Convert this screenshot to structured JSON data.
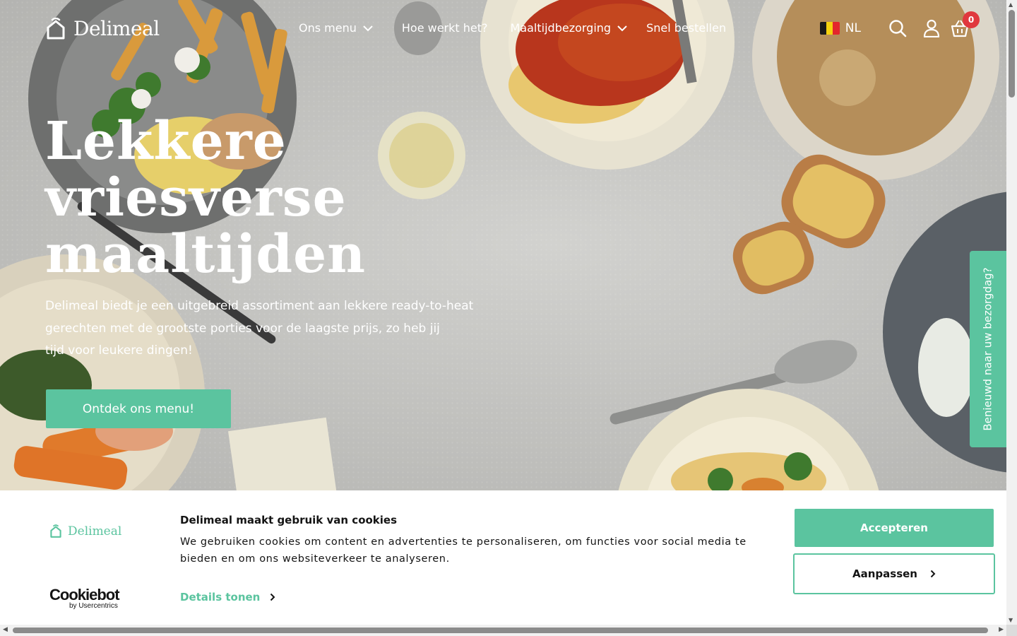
{
  "brand": {
    "name": "Delimeal",
    "accent": "#5bc49f",
    "badge_color": "#e0383e"
  },
  "nav": {
    "items": [
      {
        "label": "Ons menu",
        "has_dropdown": true
      },
      {
        "label": "Hoe werkt het?",
        "has_dropdown": false
      },
      {
        "label": "Maaltijdbezorging",
        "has_dropdown": true
      },
      {
        "label": "Snel bestellen",
        "has_dropdown": false
      }
    ]
  },
  "header": {
    "language": "NL",
    "icons": [
      "belgium-flag-icon",
      "search-icon",
      "user-icon",
      "basket-icon"
    ],
    "cart_count": "0"
  },
  "hero": {
    "title_lines": [
      "Lekkere",
      "vriesverse",
      "maaltijden"
    ],
    "description_lines": [
      "Delimeal biedt je een uitgebreid assortiment aan lekkere ready-to-heat",
      "gerechten met de grootste porties voor de laagste prijs, zo heb jij",
      "tijd voor leukere dingen!"
    ],
    "cta_label": "Ontdek ons menu!",
    "side_tab_label": "Benieuwd naar uw bezorgdag?"
  },
  "cookie_banner": {
    "brand": "Delimeal",
    "title": "Delimeal maakt gebruik van cookies",
    "text": "We gebruiken cookies om content en advertenties te personaliseren, om functies voor social media te bieden en om ons websiteverkeer te analyseren.",
    "details_label": "Details tonen",
    "accept_label": "Accepteren",
    "customize_label": "Aanpassen",
    "provider": "Cookiebot",
    "provider_sub": "by Usercentrics"
  }
}
